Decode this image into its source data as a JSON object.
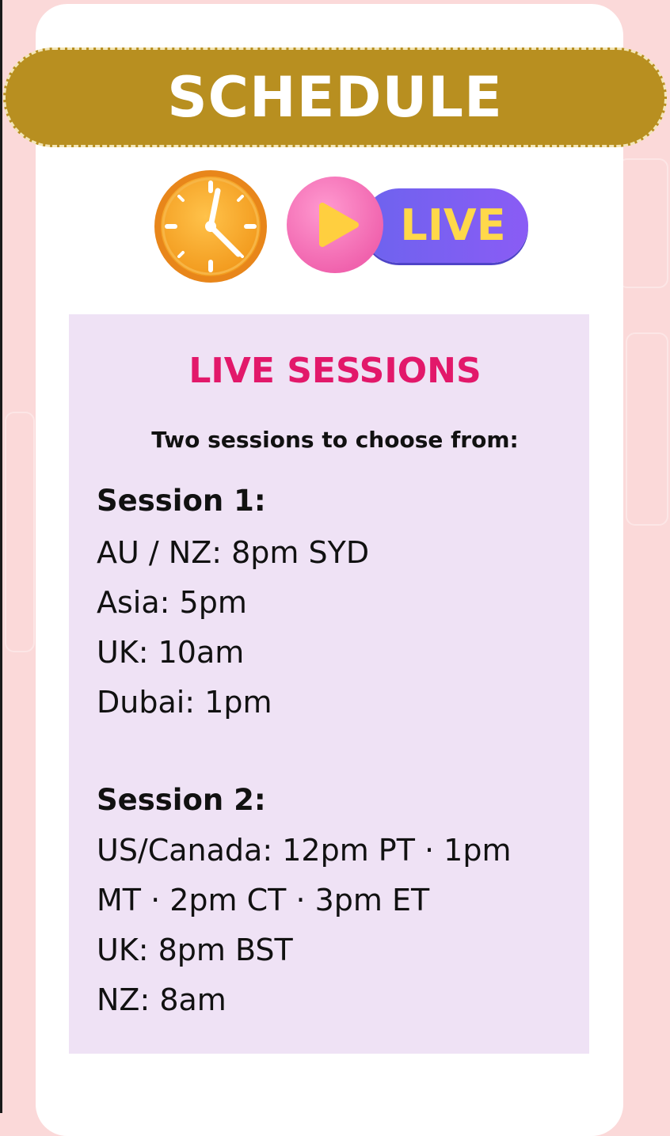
{
  "banner": {
    "title": "SCHEDULE"
  },
  "badge": {
    "label": "LIVE"
  },
  "panel": {
    "title": "LIVE SESSIONS",
    "subtitle": "Two sessions to choose from:",
    "session1": {
      "heading": "Session 1:",
      "lines": [
        "AU / NZ: 8pm SYD",
        "Asia: 5pm",
        "UK: 10am",
        "Dubai: 1pm"
      ]
    },
    "session2": {
      "heading": "Session 2:",
      "lines": [
        "US/Canada: 12pm PT · 1pm",
        "MT · 2pm CT · 3pm ET",
        "UK: 8pm BST",
        "NZ: 8am"
      ]
    }
  },
  "colors": {
    "background": "#fbd9d9",
    "banner": "#b88f20",
    "panel": "#efe2f5",
    "title_accent": "#e2186a",
    "live_pill": "#6d63ee",
    "live_text": "#ffd84a"
  },
  "icons": [
    "clock-icon",
    "play-icon"
  ]
}
